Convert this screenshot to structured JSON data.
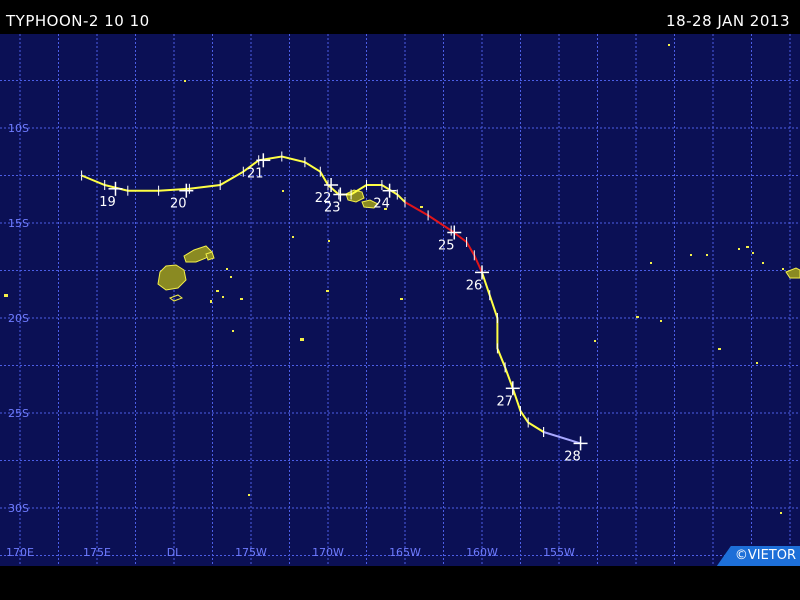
{
  "header": {
    "title": "TYPHOON-2 10 10",
    "date_range": "18-28 JAN 2013"
  },
  "credit": "©VIETOR",
  "colors": {
    "ocean": "#0b1055",
    "grid": "#4c5ee6",
    "axis_label": "#6f7cff",
    "land": "#8a8a22",
    "land_outline": "#f3ef4a",
    "track_tropical_storm": "#ffff44",
    "track_typhoon": "#e0151a",
    "track_extratropical": "#a8a8ff",
    "day_label": "#ffffff"
  },
  "axes": {
    "longitude_labels": [
      "170E",
      "175E",
      "DL",
      "175W",
      "170W",
      "165W",
      "160W",
      "155W"
    ],
    "latitude_labels": [
      "10S",
      "15S",
      "20S",
      "25S",
      "30S"
    ]
  },
  "track": {
    "day_labels": [
      "19",
      "20",
      "21",
      "22",
      "23",
      "24",
      "25",
      "26",
      "27",
      "28"
    ],
    "segments": [
      {
        "intensity": "tropical-storm",
        "points": [
          [
            174.0,
            -12.5
          ],
          [
            175.5,
            -13.0
          ],
          [
            177.0,
            -13.3
          ],
          [
            179.0,
            -13.3
          ],
          [
            -179.0,
            -13.2
          ],
          [
            -177.0,
            -13.0
          ],
          [
            -175.5,
            -12.3
          ],
          [
            -174.5,
            -11.7
          ],
          [
            -173.0,
            -11.5
          ],
          [
            -171.5,
            -11.8
          ],
          [
            -170.5,
            -12.3
          ],
          [
            -170.0,
            -13.0
          ],
          [
            -169.3,
            -13.5
          ],
          [
            -168.5,
            -13.5
          ],
          [
            -167.5,
            -13.0
          ],
          [
            -166.5,
            -13.0
          ],
          [
            -165.5,
            -13.5
          ],
          [
            -165.0,
            -13.9
          ]
        ]
      },
      {
        "intensity": "typhoon",
        "points": [
          [
            -165.0,
            -13.9
          ],
          [
            -163.5,
            -14.6
          ],
          [
            -162.0,
            -15.4
          ],
          [
            -161.0,
            -16.0
          ],
          [
            -160.5,
            -16.7
          ],
          [
            -160.0,
            -17.6
          ]
        ]
      },
      {
        "intensity": "tropical-storm",
        "points": [
          [
            -160.0,
            -17.6
          ],
          [
            -159.5,
            -18.8
          ],
          [
            -159.0,
            -20.0
          ],
          [
            -159.0,
            -21.6
          ],
          [
            -158.5,
            -22.6
          ],
          [
            -158.0,
            -23.7
          ],
          [
            -157.5,
            -24.9
          ],
          [
            -157.0,
            -25.5
          ],
          [
            -156.0,
            -26.0
          ]
        ]
      },
      {
        "intensity": "extratropical",
        "points": [
          [
            -156.0,
            -26.0
          ],
          [
            -153.6,
            -26.6
          ]
        ]
      }
    ],
    "day_markers": [
      {
        "day": "19",
        "lon": 176.2,
        "lat": -13.2
      },
      {
        "day": "20",
        "lon": -179.2,
        "lat": -13.3
      },
      {
        "day": "21",
        "lon": -174.2,
        "lat": -11.7
      },
      {
        "day": "22",
        "lon": -169.8,
        "lat": -13.0
      },
      {
        "day": "23",
        "lon": -169.2,
        "lat": -13.5
      },
      {
        "day": "24",
        "lon": -166.0,
        "lat": -13.3
      },
      {
        "day": "25",
        "lon": -161.8,
        "lat": -15.5
      },
      {
        "day": "26",
        "lon": -160.0,
        "lat": -17.6
      },
      {
        "day": "27",
        "lon": -158.0,
        "lat": -23.7
      },
      {
        "day": "28",
        "lon": -153.6,
        "lat": -26.6
      }
    ]
  }
}
